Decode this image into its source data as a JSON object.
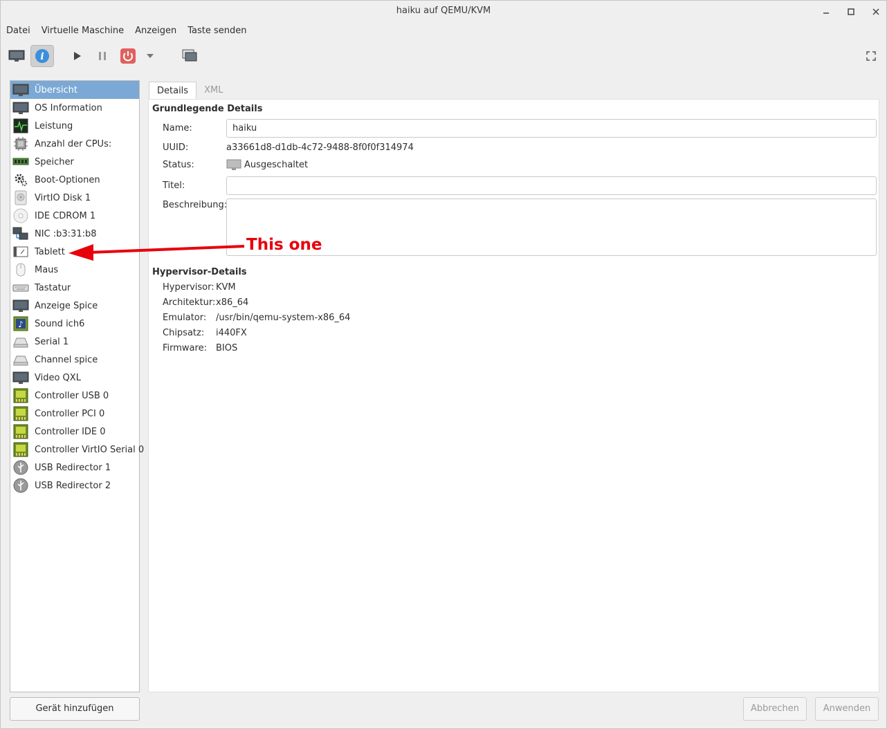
{
  "window": {
    "title": "haiku auf QEMU/KVM"
  },
  "menu": [
    "Datei",
    "Virtuelle Maschine",
    "Anzeigen",
    "Taste senden"
  ],
  "toolbar": {
    "buttons": [
      "monitor-icon",
      "info-icon",
      "play-icon",
      "pause-icon",
      "power-icon",
      "dropdown-icon",
      "screens-icon",
      "fullscreen-icon"
    ]
  },
  "sidebar": {
    "items": [
      {
        "label": "Übersicht",
        "icon": "monitor-icon"
      },
      {
        "label": "OS Information",
        "icon": "monitor-icon"
      },
      {
        "label": "Leistung",
        "icon": "performance-icon"
      },
      {
        "label": "Anzahl der CPUs:",
        "icon": "cpu-icon"
      },
      {
        "label": "Speicher",
        "icon": "memory-icon"
      },
      {
        "label": "Boot-Optionen",
        "icon": "gears-icon"
      },
      {
        "label": "VirtIO Disk 1",
        "icon": "disk-icon"
      },
      {
        "label": "IDE CDROM 1",
        "icon": "cdrom-icon"
      },
      {
        "label": "NIC :b3:31:b8",
        "icon": "network-icon"
      },
      {
        "label": "Tablett",
        "icon": "tablet-icon"
      },
      {
        "label": "Maus",
        "icon": "mouse-icon"
      },
      {
        "label": "Tastatur",
        "icon": "keyboard-icon"
      },
      {
        "label": "Anzeige Spice",
        "icon": "monitor-icon"
      },
      {
        "label": "Sound ich6",
        "icon": "sound-icon"
      },
      {
        "label": "Serial 1",
        "icon": "serial-icon"
      },
      {
        "label": "Channel spice",
        "icon": "serial-icon"
      },
      {
        "label": "Video QXL",
        "icon": "monitor-icon"
      },
      {
        "label": "Controller USB 0",
        "icon": "controller-icon"
      },
      {
        "label": "Controller PCI 0",
        "icon": "controller-icon"
      },
      {
        "label": "Controller IDE 0",
        "icon": "controller-icon"
      },
      {
        "label": "Controller VirtIO Serial 0",
        "icon": "controller-icon"
      },
      {
        "label": "USB Redirector 1",
        "icon": "usb-icon"
      },
      {
        "label": "USB Redirector 2",
        "icon": "usb-icon"
      }
    ],
    "add_button": "Gerät hinzufügen"
  },
  "tabs": [
    "Details",
    "XML"
  ],
  "basic": {
    "title": "Grundlegende Details",
    "name_label": "Name:",
    "name_value": "haiku",
    "uuid_label": "UUID:",
    "uuid_value": "a33661d8-d1db-4c72-9488-8f0f0f314974",
    "status_label": "Status:",
    "status_value": "Ausgeschaltet",
    "titel_label": "Titel:",
    "titel_value": "",
    "desc_label": "Beschreibung:",
    "desc_value": ""
  },
  "hypervisor": {
    "title": "Hypervisor-Details",
    "rows": [
      {
        "label": "Hypervisor:",
        "value": "KVM"
      },
      {
        "label": "Architektur:",
        "value": "x86_64"
      },
      {
        "label": "Emulator:",
        "value": "/usr/bin/qemu-system-x86_64"
      },
      {
        "label": "Chipsatz:",
        "value": "i440FX"
      },
      {
        "label": "Firmware:",
        "value": "BIOS"
      }
    ]
  },
  "footer": {
    "cancel": "Abbrechen",
    "apply": "Anwenden"
  },
  "annotation": {
    "text": "This one",
    "color": "#e8000b"
  },
  "colors": {
    "selection": "#7ba8d4",
    "power": "#e06060",
    "info": "#3d8fdc"
  }
}
